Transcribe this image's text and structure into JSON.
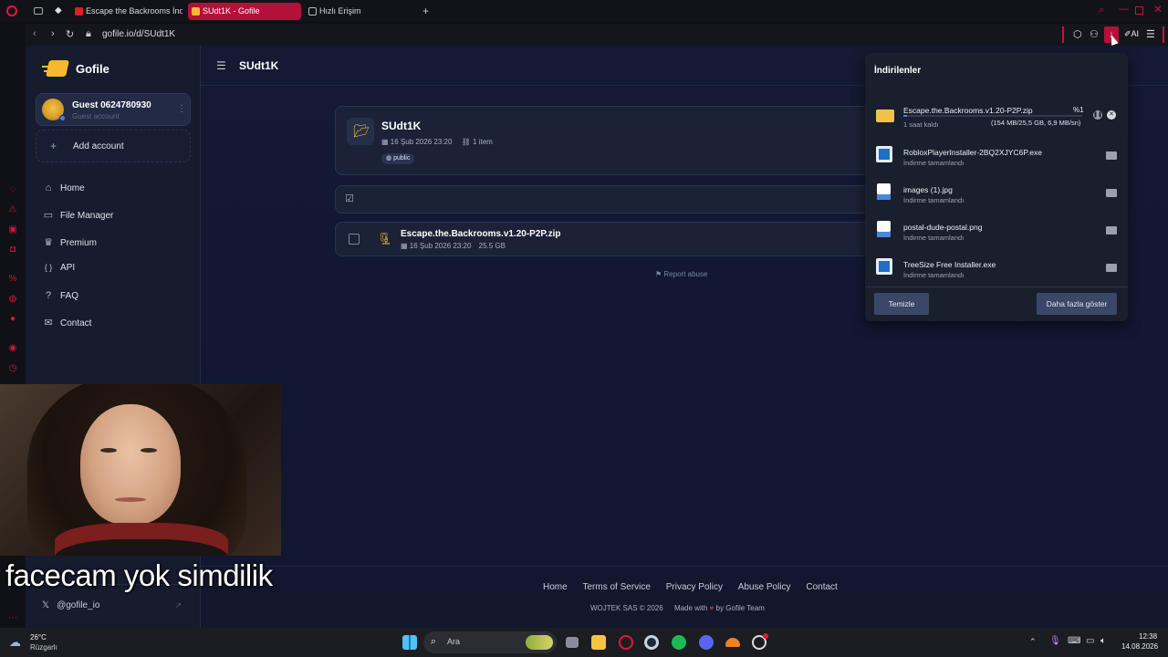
{
  "browser": {
    "tabs": [
      {
        "label": "Escape the Backrooms İnd",
        "active": false
      },
      {
        "label": "SUdt1K - Gofile",
        "active": true
      },
      {
        "label": "Hızlı Erişim",
        "active": false
      }
    ],
    "address": "gofile.io/d/SUdt1K",
    "ai_label": "AI"
  },
  "sidebar": {
    "brand": "Gofile",
    "user_name": "Guest 0624780930",
    "user_role": "Guest account",
    "add_account": "Add account",
    "nav": [
      {
        "label": "Home",
        "icon": "home-icon",
        "glyph": "⌂"
      },
      {
        "label": "File Manager",
        "icon": "folder-icon",
        "glyph": "▭"
      },
      {
        "label": "Premium",
        "icon": "crown-icon",
        "glyph": "♛"
      },
      {
        "label": "API",
        "icon": "braces-icon",
        "glyph": "{ }"
      },
      {
        "label": "FAQ",
        "icon": "question-icon",
        "glyph": "?"
      },
      {
        "label": "Contact",
        "icon": "mail-icon",
        "glyph": "✉"
      }
    ],
    "social": "@gofile_io"
  },
  "main": {
    "page_title": "SUdt1K",
    "folder": {
      "name": "SUdt1K",
      "date": "16 Şub 2026 23:20",
      "items": "1 item",
      "visibility": "public"
    },
    "file": {
      "name": "Escape.the.Backrooms.v1.20-P2P.zip",
      "date": "16 Şub 2026 23:20",
      "size": "25.5 GB"
    },
    "report": "Report abuse",
    "footer_links": [
      "Home",
      "Terms of Service",
      "Privacy Policy",
      "Abuse Policy",
      "Contact"
    ],
    "copyright": "WOJTEK SAS © 2026",
    "made_with_prefix": "Made with",
    "made_with_suffix": "by Gofile Team"
  },
  "downloads": {
    "title": "İndirilenler",
    "active": {
      "name": "Escape.the.Backrooms.v1.20-P2P.zip",
      "percent_label": "%1",
      "progress": 0.01,
      "time_left": "1 saat kaldı",
      "stats": "(154 MB/25,5 GB, 6,9 MB/sn)"
    },
    "items": [
      {
        "name": "RobloxPlayerInstaller-2BQ2XJYC6P.exe",
        "status": "İndirme tamamlandı",
        "kind": "exe"
      },
      {
        "name": "images (1).jpg",
        "status": "İndirme tamamlandı",
        "kind": "image"
      },
      {
        "name": "postal-dude-postal.png",
        "status": "İndirme tamamlandı",
        "kind": "image"
      },
      {
        "name": "TreeSize Free Installer.exe",
        "status": "İndirme tamamlandı",
        "kind": "exe"
      }
    ],
    "clear_label": "Temizle",
    "more_label": "Daha fazla göster"
  },
  "overlay": {
    "caption": "facecam yok simdilik"
  },
  "taskbar": {
    "weather_temp": "26°C",
    "weather_desc": "Rüzgarlı",
    "search_placeholder": "Ara",
    "time": "12:38",
    "date": "14.08.2026"
  },
  "colors": {
    "accent": "#b3103a",
    "gofile_yellow": "#f5b82e",
    "panel_bg": "#1a1f2e",
    "button_bg": "#3a4766"
  }
}
